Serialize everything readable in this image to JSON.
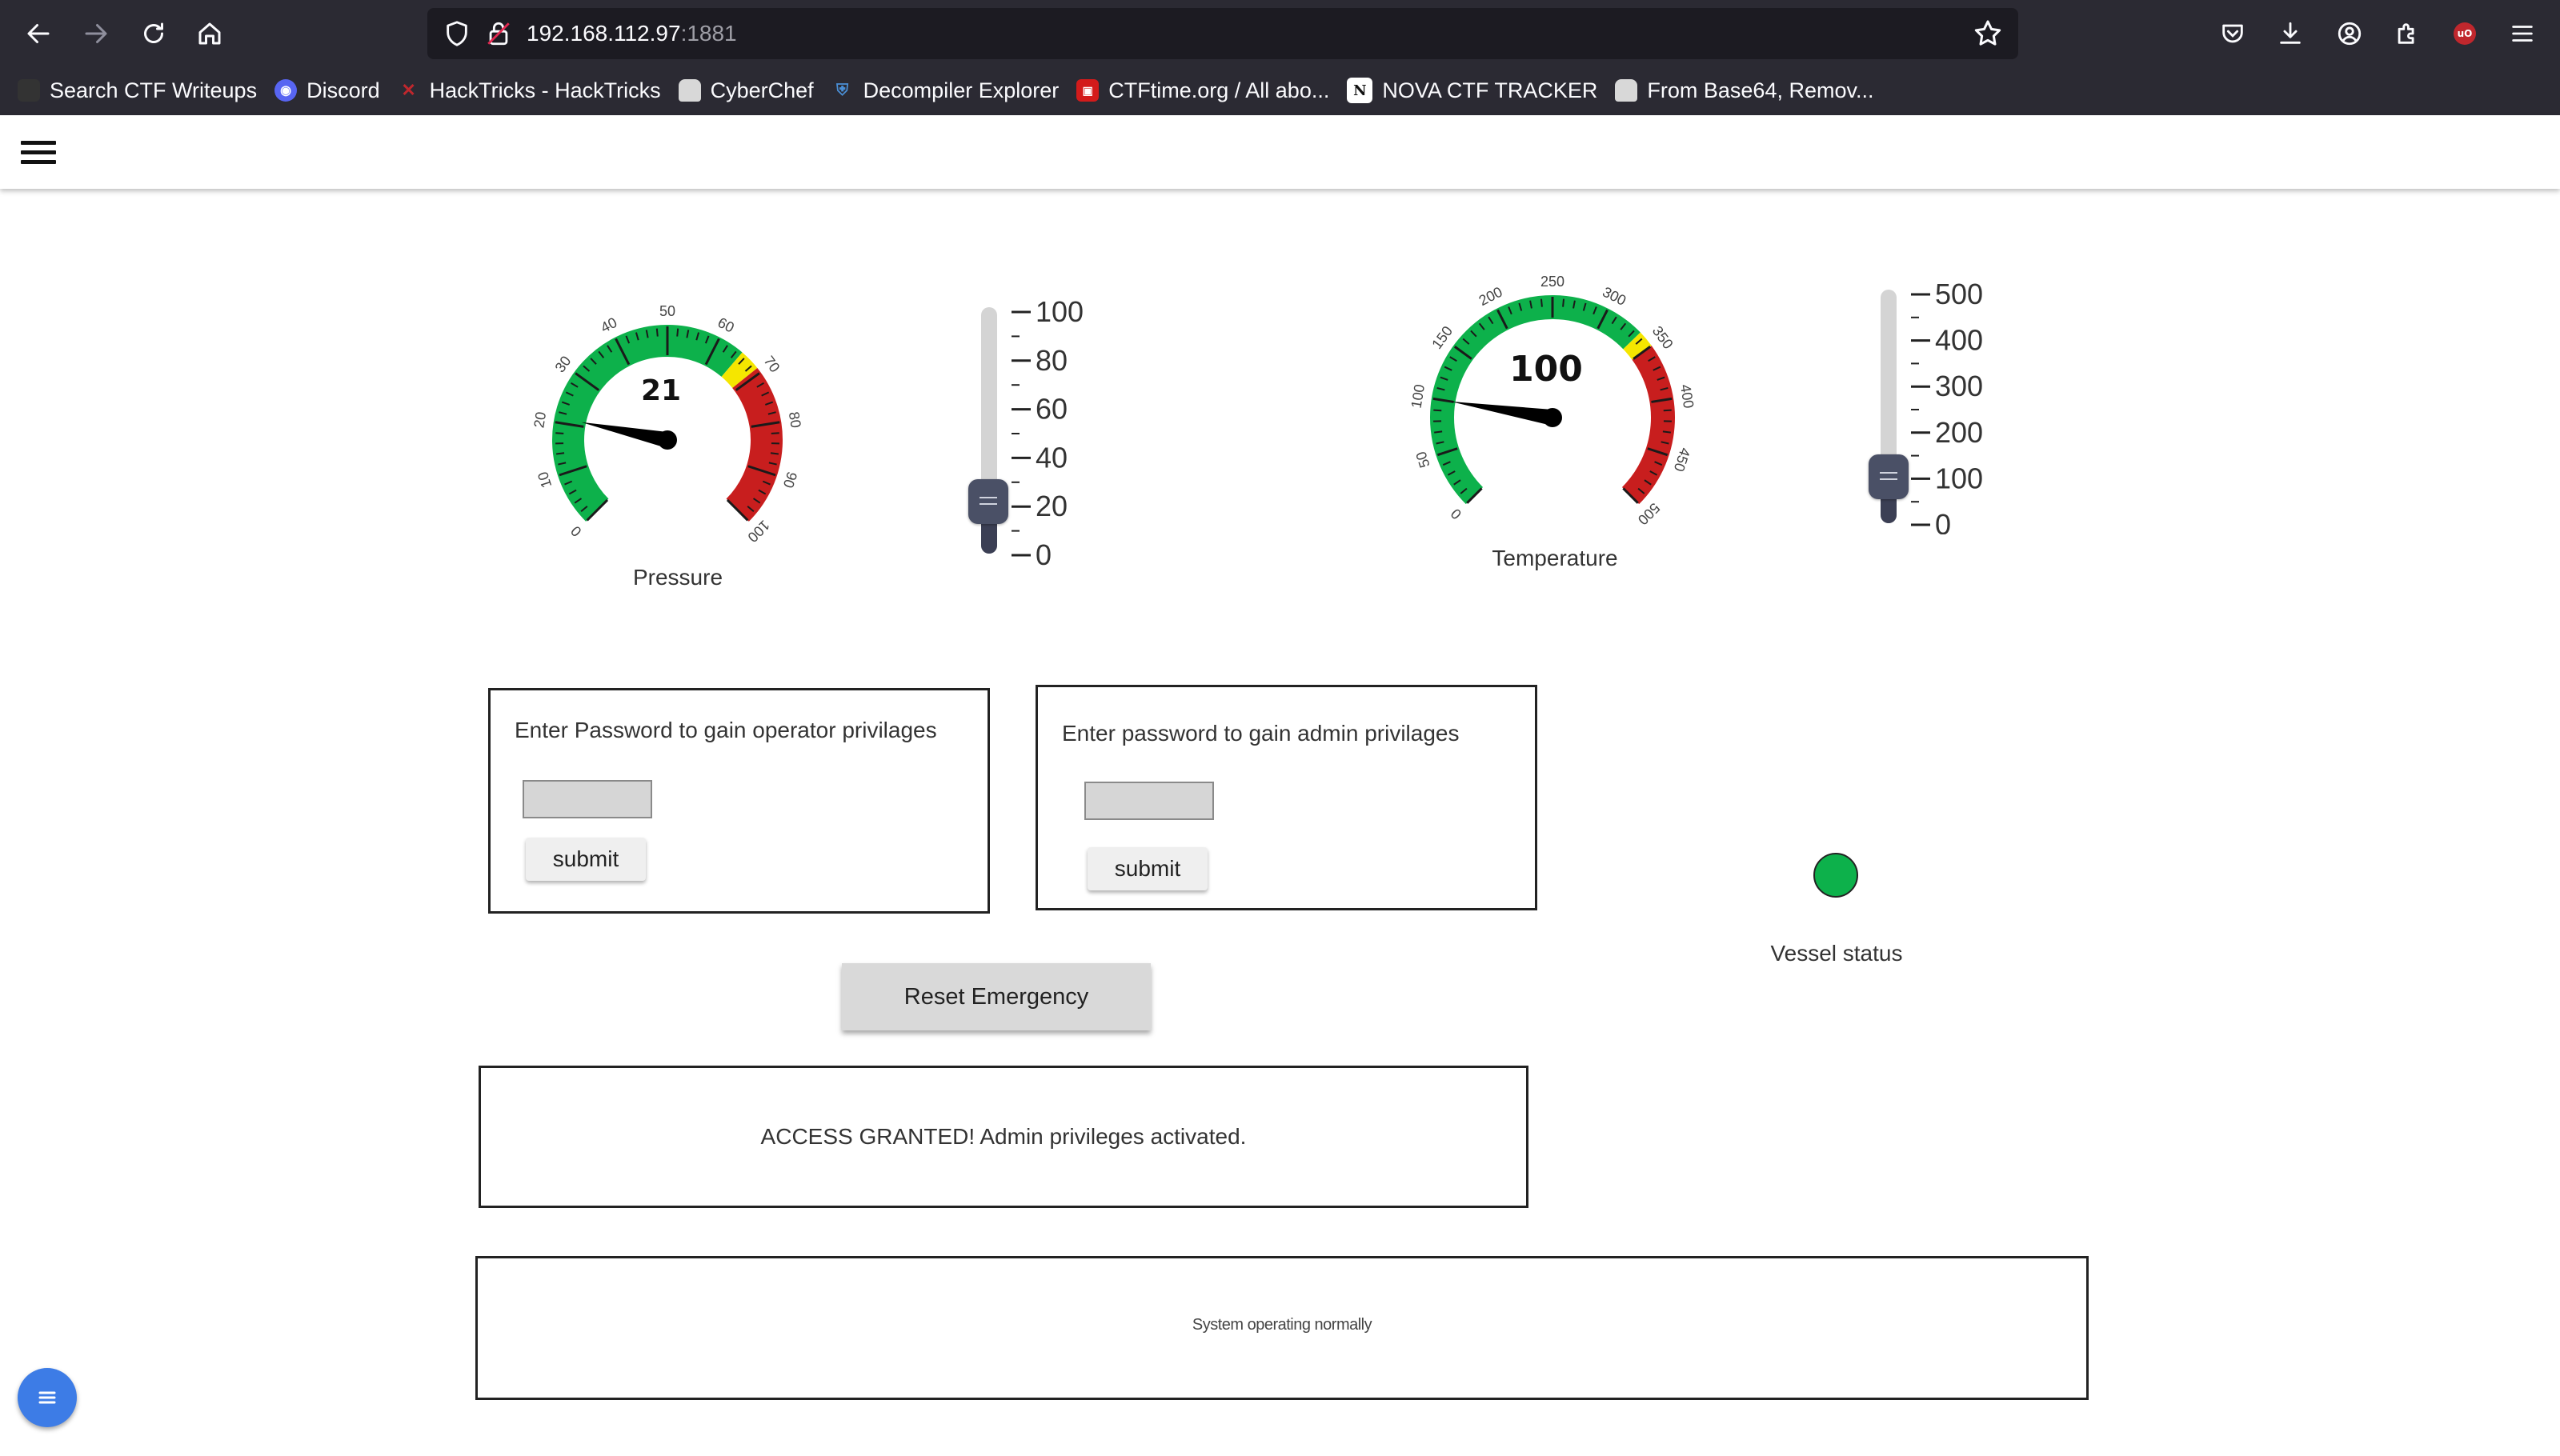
{
  "browser": {
    "url_host": "192.168.112.97",
    "url_port": ":1881",
    "bookmarks": [
      {
        "label": "Search CTF Writeups",
        "icon": "ctf-writeups-icon",
        "color": "#333333"
      },
      {
        "label": "Discord",
        "icon": "discord-icon",
        "color": "#5865f2"
      },
      {
        "label": "HackTricks - HackTricks",
        "icon": "hacktricks-icon",
        "color": "#c0272d"
      },
      {
        "label": "CyberChef",
        "icon": "cyberchef-icon",
        "color": "#d8d8d8"
      },
      {
        "label": "Decompiler Explorer",
        "icon": "decompiler-icon",
        "color": "#4a8fd6"
      },
      {
        "label": "CTFtime.org / All abo...",
        "icon": "ctftime-icon",
        "color": "#d31b1b"
      },
      {
        "label": "NOVA CTF TRACKER",
        "icon": "notion-icon",
        "color": "#ffffff"
      },
      {
        "label": "From Base64, Remov...",
        "icon": "cyberchef-icon",
        "color": "#d8d8d8"
      }
    ]
  },
  "pressure": {
    "label": "Pressure",
    "value": 21,
    "min": 0,
    "max": 100,
    "ticks": [
      "0",
      "10",
      "20",
      "30",
      "40",
      "50",
      "60",
      "70",
      "80",
      "90",
      "100"
    ],
    "green_until": 65,
    "yellow_until": 69,
    "slider": {
      "value": 21,
      "min": 0,
      "max": 100,
      "ticks": [
        "100",
        "80",
        "60",
        "40",
        "20",
        "0"
      ]
    }
  },
  "temperature": {
    "label": "Temperature",
    "value": 100,
    "min": 0,
    "max": 500,
    "ticks": [
      "0",
      "50",
      "100",
      "150",
      "200",
      "250",
      "300",
      "350",
      "400",
      "450",
      "500"
    ],
    "green_until": 335,
    "yellow_until": 350,
    "slider": {
      "value": 100,
      "min": 0,
      "max": 500,
      "ticks": [
        "500",
        "400",
        "300",
        "200",
        "100",
        "0"
      ]
    }
  },
  "operator_panel": {
    "title": "Enter Password to gain operator privilages",
    "submit_label": "submit"
  },
  "admin_panel": {
    "title": "Enter password to gain admin privilages",
    "submit_label": "submit"
  },
  "reset_label": "Reset Emergency",
  "vessel": {
    "label": "Vessel status",
    "color": "#0db14b"
  },
  "message": "ACCESS GRANTED! Admin privileges activated.",
  "system_status": "System operating normally",
  "colors": {
    "green": "#0db14b",
    "yellow": "#f5e600",
    "red": "#c81e1e",
    "needle": "#000000"
  }
}
